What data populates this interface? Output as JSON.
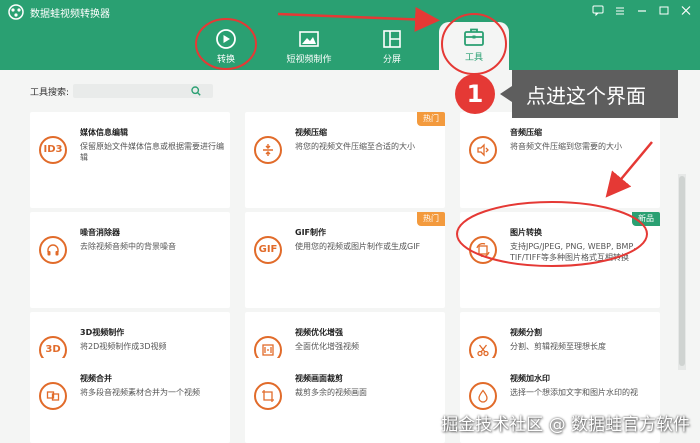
{
  "app": {
    "title": "数据蛙视频转换器"
  },
  "colors": {
    "brand": "#2aa072",
    "accent_icon": "#e16b2a",
    "hot_badge": "#f39a3d",
    "annotation_red": "#e53935"
  },
  "tabs": [
    {
      "label": "转换",
      "icon": "convert-icon"
    },
    {
      "label": "短视频制作",
      "icon": "video-maker-icon"
    },
    {
      "label": "分屏",
      "icon": "split-screen-icon"
    },
    {
      "label": "工具",
      "icon": "toolbox-icon",
      "active": true
    }
  ],
  "search": {
    "label": "工具搜索:",
    "placeholder": ""
  },
  "tools": [
    {
      "title": "媒体信息编辑",
      "desc": "保留原始文件媒体信息或根据需要进行编辑",
      "icon": "ID3",
      "badge": ""
    },
    {
      "title": "视频压缩",
      "desc": "将您的视频文件压缩至合适的大小",
      "icon": "compress-icon",
      "badge": "热门"
    },
    {
      "title": "音频压缩",
      "desc": "将音频文件压缩到您需要的大小",
      "icon": "audio-compress-icon",
      "badge": ""
    },
    {
      "title": "噪音消除器",
      "desc": "去除视频音频中的背景噪音",
      "icon": "headphones-icon",
      "badge": ""
    },
    {
      "title": "GIF制作",
      "desc": "使用您的视频或图片制作或生成GIF",
      "icon": "GIF",
      "badge": "热门"
    },
    {
      "title": "图片转换",
      "desc": "支持JPG/JPEG, PNG, WEBP, BMP, TIF/TIFF等多种图片格式互相转换",
      "icon": "image-convert-icon",
      "badge": "新品"
    },
    {
      "title": "3D视频制作",
      "desc": "将2D视频制作成3D视频",
      "icon": "3D",
      "badge": ""
    },
    {
      "title": "视频优化增强",
      "desc": "全面优化增强视频",
      "icon": "enhance-icon",
      "badge": ""
    },
    {
      "title": "视频分割",
      "desc": "分割、剪辑视频至理想长度",
      "icon": "scissors-icon",
      "badge": ""
    },
    {
      "title": "视频合并",
      "desc": "将多段音视频素材合并为一个视频",
      "icon": "merge-icon",
      "badge": ""
    },
    {
      "title": "视频画面裁剪",
      "desc": "裁剪多余的视频画面",
      "icon": "crop-icon",
      "badge": ""
    },
    {
      "title": "视频加水印",
      "desc": "选择一个想添加文字和图片水印的视",
      "icon": "drop-icon",
      "badge": ""
    }
  ],
  "annotation": {
    "number": "1",
    "text": "点进这个界面"
  },
  "watermark": "掘金技术社区 @ 数据蛙官方软件"
}
